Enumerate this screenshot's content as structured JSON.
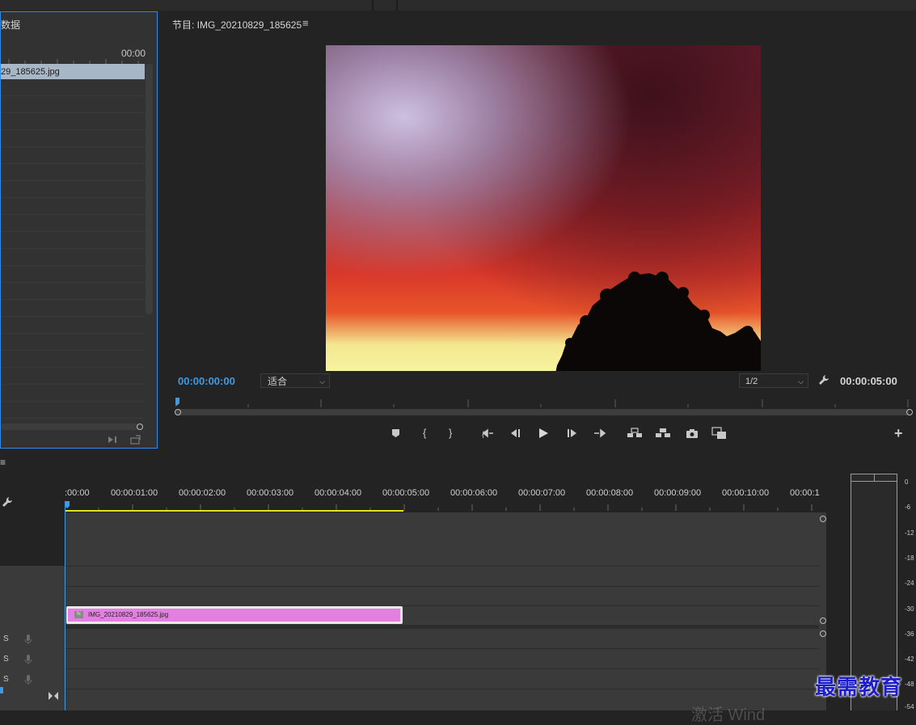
{
  "project_panel": {
    "title": "数据",
    "timecode": "00:00",
    "selected_item": "29_185625.jpg"
  },
  "program_monitor": {
    "title": "节目: IMG_20210829_185625",
    "menu_glyph": "≡",
    "current_time": "00:00:00:00",
    "fit_label": "适合",
    "resolution_label": "1/2",
    "duration": "00:00:05:00",
    "add_glyph": "+"
  },
  "timeline": {
    "menu_glyph": "≡",
    "ruler_labels": [
      ":00:00",
      "00:00:01:00",
      "00:00:02:00",
      "00:00:03:00",
      "00:00:04:00",
      "00:00:05:00",
      "00:00:06:00",
      "00:00:07:00",
      "00:00:08:00",
      "00:00:09:00",
      "00:00:10:00",
      "00:00:1"
    ],
    "clip_name": "IMG_20210829_185625.jpg",
    "clip_fx": "fx",
    "audio_tracks": [
      {
        "solo": "S"
      },
      {
        "solo": "S"
      },
      {
        "solo": "S"
      }
    ]
  },
  "audio_meter": {
    "labels": [
      "0",
      "-6",
      "-12",
      "-18",
      "-24",
      "-30",
      "-36",
      "-42",
      "-48",
      "-54"
    ]
  },
  "watermark": {
    "text": "最需教育",
    "faint_text": "激活 Wind"
  },
  "colors": {
    "accent_blue": "#3c9be6",
    "clip_pink": "#e37fe0",
    "work_area_yellow": "#e3e31f",
    "panel_focus_border": "#2d8ceb"
  }
}
